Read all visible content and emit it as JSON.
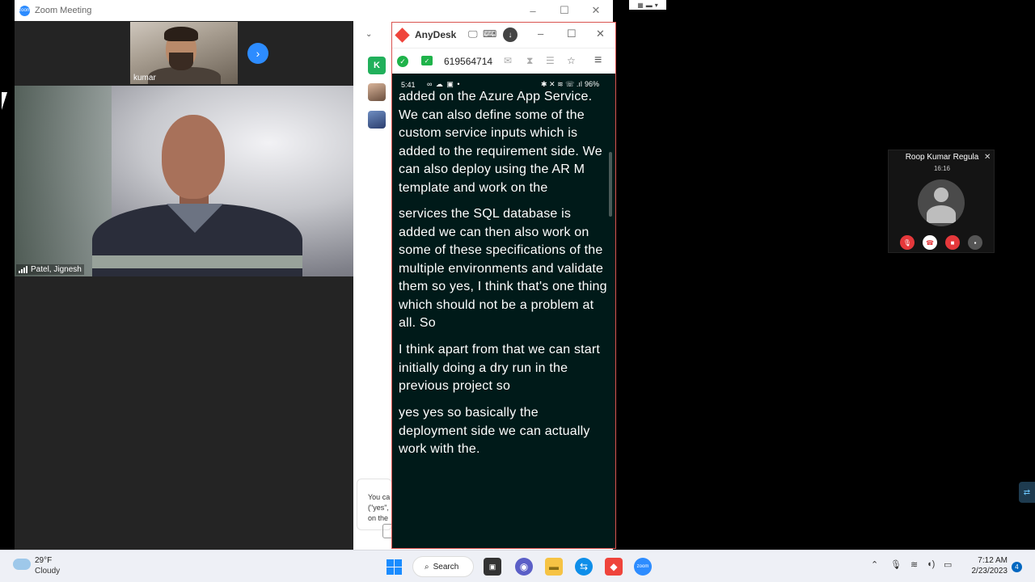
{
  "zoom": {
    "title": "Zoom Meeting",
    "window_controls": {
      "minimize": "–",
      "maximize": "☐",
      "close": "✕"
    },
    "participants": {
      "small_tile_name": "kumar",
      "main_tile_name": "Patel, Jignesh"
    },
    "chat": {
      "avatar_k_letter": "K",
      "message_lines": [
        "You ca",
        "(\"yes\",",
        "on the"
      ]
    }
  },
  "anydesk": {
    "title": "AnyDesk",
    "session_id": "619564714",
    "window_controls": {
      "minimize": "–",
      "maximize": "☐",
      "close": "✕"
    },
    "phone_status": {
      "time": "5:41",
      "battery": "96%"
    },
    "captions": [
      {
        "text": "added on the Azure App Service. We can also define some of the custom service inputs which is added to the requirement side. We can also deploy using the AR M template and work on the"
      },
      {
        "text": "services the SQL database is added we can then also work on some of these specifications of the multiple environments and validate them so yes, I think that's one thing which should not be a problem at all. So"
      },
      {
        "text": "I think apart from that we can start initially doing a dry run in the previous project so"
      },
      {
        "text": "yes yes so basically the deployment side we can actually work with the."
      }
    ]
  },
  "mini_call": {
    "name": "Roop Kumar Regula",
    "time": "16:16",
    "close": "✕",
    "button_colors": {
      "mute": "#e5383b",
      "end": "#ffffff",
      "video": "#e5383b",
      "more": "#555555"
    }
  },
  "taskbar": {
    "weather": {
      "temp": "29°F",
      "condition": "Cloudy"
    },
    "search_label": "Search",
    "clock": {
      "time": "7:12 AM",
      "date": "2/23/2023"
    },
    "notification_count": "4",
    "apps": [
      "start-icon",
      "file-explorer-icon",
      "teams-icon",
      "folder-icon",
      "teamviewer-icon",
      "anydesk-icon",
      "zoom-icon"
    ]
  },
  "colors": {
    "zoom_blue": "#2d8cff",
    "anydesk_red": "#ef443b",
    "anydesk_green": "#1fb34a",
    "chat_avatar_green": "#21b05b"
  }
}
